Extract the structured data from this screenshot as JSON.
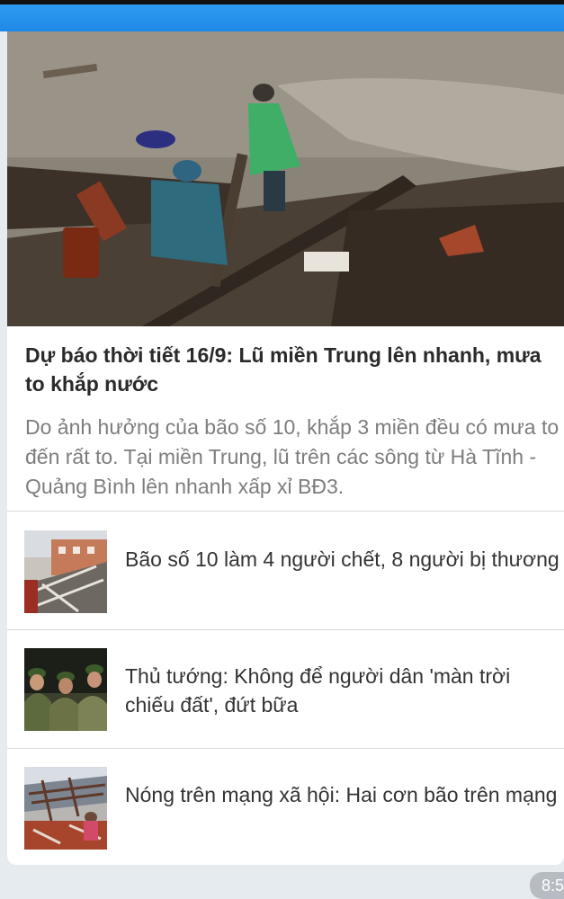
{
  "status_bar": {
    "time": "8:5"
  },
  "colors": {
    "app_bar": "#2a93ec",
    "background": "#e6ebf0",
    "card": "#ffffff"
  },
  "featured": {
    "image": "flood-debris-photo",
    "headline": "Dự báo thời tiết 16/9: Lũ miền Trung lên nhanh, mưa to khắp nước",
    "summary": "Do ảnh hưởng của bão số 10, khắp 3 miền đều có mưa to đến rất to. Tại miền Trung, lũ trên các sông từ Hà Tĩnh - Quảng Bình lên nhanh xấp xỉ BĐ3."
  },
  "articles": [
    {
      "title": "Bão số 10 làm 4 người chết, 8 người bị thương",
      "image": "collapsed-building-photo"
    },
    {
      "title": "Thủ tướng: Không để người dân 'màn trời chiếu đất', đứt bữa",
      "image": "officials-photo"
    },
    {
      "title": "Nóng trên mạng xã hội: Hai cơn bão trên mạng",
      "image": "storm-damage-photo"
    }
  ]
}
